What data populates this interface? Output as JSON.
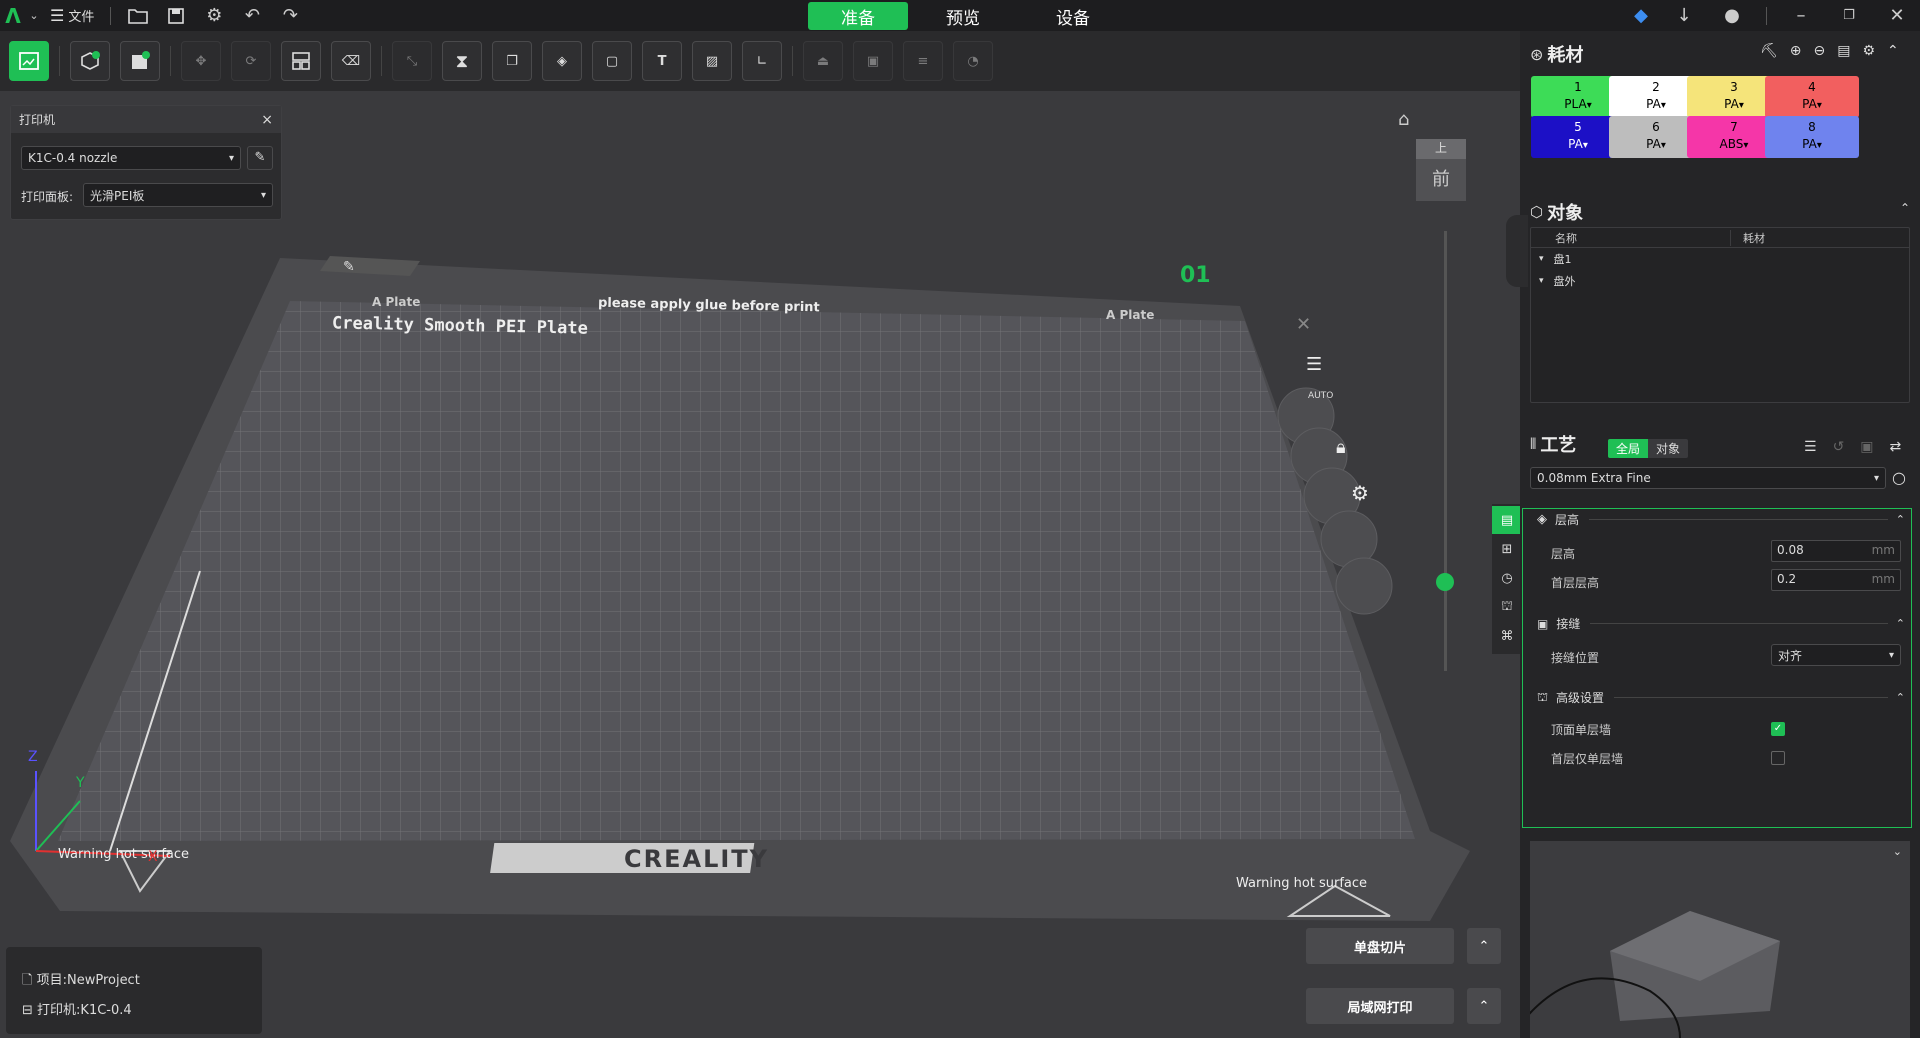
{
  "topbar": {
    "file_label": "文件",
    "tabs": [
      {
        "label": "准备",
        "active": true
      },
      {
        "label": "预览"
      },
      {
        "label": "设备"
      }
    ]
  },
  "printer_panel": {
    "title": "打印机",
    "close": "×",
    "printer": "K1C-0.4 nozzle",
    "plate_label": "打印面板:",
    "plate_value": "光滑PEI板"
  },
  "plate": {
    "plate_name": "Creality Smooth PEI Plate",
    "glue_note": "please apply glue before print",
    "side_label_left": "A Plate",
    "side_label_right": "A Plate",
    "brand": "CREALITY",
    "warning_left": "Warning hot surface",
    "warning_right": "Warning hot surface",
    "plate_index": "01",
    "auto_label": "AUTO"
  },
  "view_cube": {
    "top": "上",
    "front": "前"
  },
  "filament": {
    "title": "耗材",
    "slots": [
      {
        "num": "1",
        "type": "PLA",
        "color": "#3ddc57",
        "text": "#000"
      },
      {
        "num": "2",
        "type": "PA",
        "color": "#ffffff",
        "text": "#000"
      },
      {
        "num": "3",
        "type": "PA",
        "color": "#f5e47a",
        "text": "#000"
      },
      {
        "num": "4",
        "type": "PA",
        "color": "#f25f5f",
        "text": "#000"
      },
      {
        "num": "5",
        "type": "PA",
        "color": "#1c10c6",
        "text": "#fff"
      },
      {
        "num": "6",
        "type": "PA",
        "color": "#bdbdbd",
        "text": "#000"
      },
      {
        "num": "7",
        "type": "ABS",
        "color": "#f536a8",
        "text": "#000"
      },
      {
        "num": "8",
        "type": "PA",
        "color": "#6f83ee",
        "text": "#000"
      }
    ]
  },
  "objects": {
    "title": "对象",
    "col_name": "名称",
    "col_filament": "耗材",
    "rows": [
      "盘1",
      "盘外"
    ]
  },
  "process": {
    "title": "工艺",
    "tab_global": "全局",
    "tab_object": "对象",
    "preset": "0.08mm Extra Fine",
    "group_layer": "层高",
    "layer_height_label": "层高",
    "layer_height": "0.08",
    "first_layer_label": "首层层高",
    "first_layer": "0.2",
    "unit": "mm",
    "group_seam": "接缝",
    "seam_pos_label": "接缝位置",
    "seam_pos": "对齐",
    "group_adv": "高级设置",
    "top_single_wall_label": "顶面单层墙",
    "top_single_wall": true,
    "first_single_wall_label": "首层仅单层墙",
    "first_single_wall": false
  },
  "footer": {
    "project": "项目:NewProject",
    "printer": "打印机:K1C-0.4"
  },
  "actions": {
    "slice": "单盘切片",
    "print": "局域网打印"
  }
}
